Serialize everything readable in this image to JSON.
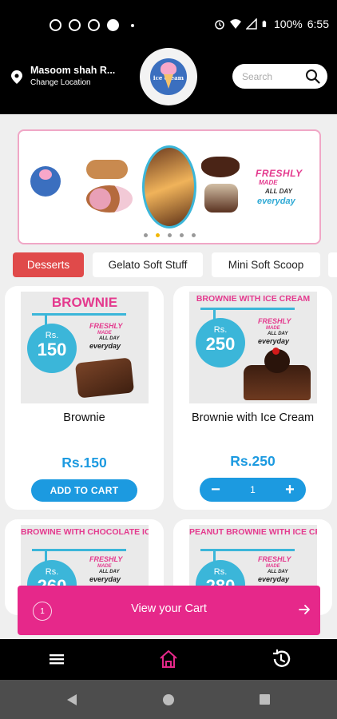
{
  "status_bar": {
    "battery": "100%",
    "time": "6:55"
  },
  "header": {
    "location_name": "Masoom shah R...",
    "change_location": "Change Location",
    "search_placeholder": "Search",
    "logo_text": "ice cream"
  },
  "banner": {
    "tag_line_1": "FRESHLY",
    "tag_line_2": "MADE",
    "tag_line_3": "ALL DAY",
    "tag_line_4": "everyday",
    "slides": 5,
    "active_slide": 2
  },
  "categories": [
    {
      "label": "Desserts",
      "active": true
    },
    {
      "label": "Gelato Soft Stuff",
      "active": false
    },
    {
      "label": "Mini Soft Scoop",
      "active": false
    }
  ],
  "products": [
    {
      "image_title": "BROWNIE",
      "image_rs": "Rs.",
      "image_price": "150",
      "name": "Brownie",
      "price": "Rs.150",
      "action": "ADD TO CART"
    },
    {
      "image_title": "BROWNIE WITH ICE CREAM",
      "image_rs": "Rs.",
      "image_price": "250",
      "name": "Brownie with Ice Cream",
      "price": "Rs.250",
      "quantity": "1",
      "minus": "−",
      "plus": "+"
    },
    {
      "image_title": "BROWINE WITH CHOCOLATE ICE CREAM",
      "image_rs": "Rs.",
      "image_price": "260"
    },
    {
      "image_title": "PEANUT BROWNIE WITH ICE CREAM",
      "image_rs": "Rs.",
      "image_price": "280"
    }
  ],
  "image_tag": {
    "l1": "FRESHLY",
    "l2": "MADE",
    "l3": "ALL DAY",
    "l4": "everyday"
  },
  "cart": {
    "count": "1",
    "label": "View your Cart"
  },
  "bottom_nav": [
    "menu-icon",
    "home-icon",
    "history-icon"
  ],
  "colors": {
    "accent_pink": "#e6288a",
    "accent_blue": "#1c9ae0",
    "active_tab": "#e04a4a",
    "home_icon": "#e6288a"
  }
}
